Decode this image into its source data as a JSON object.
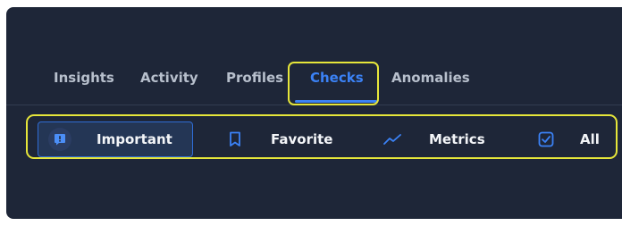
{
  "tabs": [
    {
      "label": "Insights",
      "active": false
    },
    {
      "label": "Activity",
      "active": false
    },
    {
      "label": "Profiles",
      "active": false
    },
    {
      "label": "Checks",
      "active": true
    },
    {
      "label": "Anomalies",
      "active": false
    }
  ],
  "filters": [
    {
      "label": "Important",
      "icon": "important-icon",
      "selected": true
    },
    {
      "label": "Favorite",
      "icon": "bookmark-icon",
      "selected": false
    },
    {
      "label": "Metrics",
      "icon": "trend-line-icon",
      "selected": false
    },
    {
      "label": "All",
      "icon": "checked-box-icon",
      "selected": false
    }
  ],
  "colors": {
    "panel_bg": "#1e2638",
    "accent": "#3b82f6",
    "highlight": "#e6e63a",
    "text": "#f3f5f8",
    "muted_text": "#b7bfcc"
  }
}
